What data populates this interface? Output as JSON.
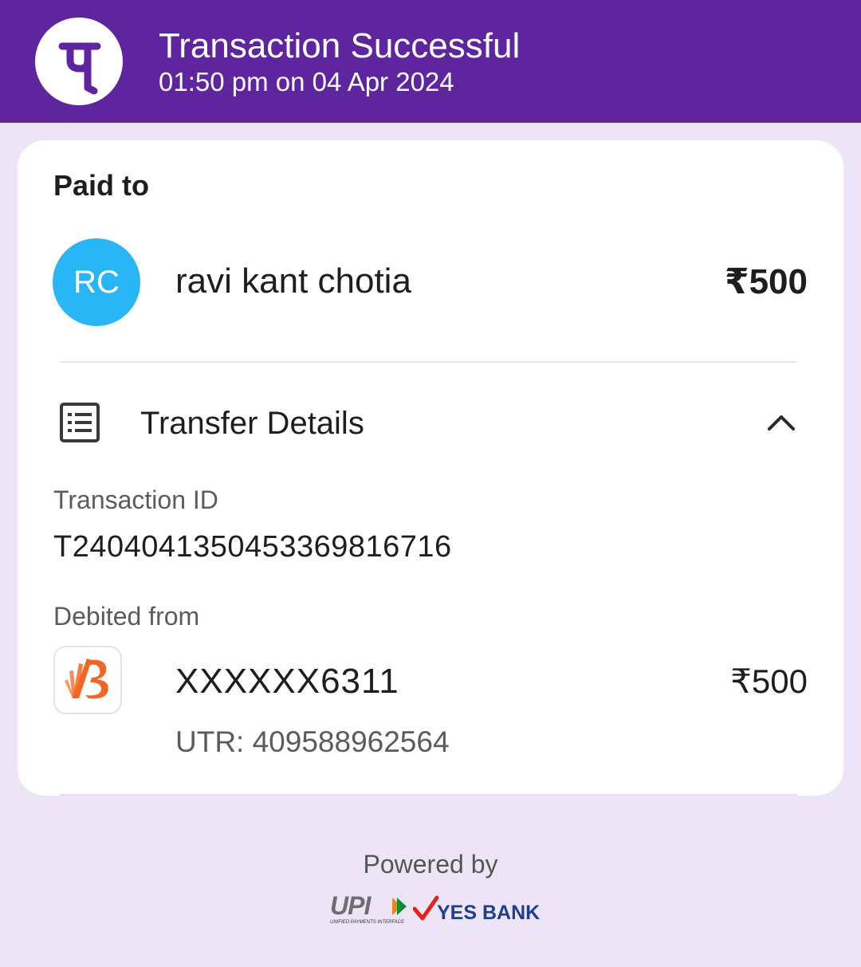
{
  "header": {
    "title": "Transaction Successful",
    "subtitle": "01:50 pm on 04 Apr 2024",
    "logo_icon": "phonepe-logo",
    "bg_color": "#5f259f"
  },
  "paid_to": {
    "label": "Paid to",
    "avatar_initials": "RC",
    "avatar_color": "#29b6f6",
    "name": "ravi kant chotia",
    "amount": "₹500"
  },
  "transfer_details": {
    "title": "Transfer Details",
    "icon": "receipt-list-icon",
    "toggle_icon": "chevron-up-icon",
    "transaction_id_label": "Transaction ID",
    "transaction_id": "T2404041350453369816716",
    "debited_from_label": "Debited from",
    "bank_icon": "bank-of-baroda-logo",
    "account": "XXXXXX6311",
    "amount": "₹500",
    "utr": "UTR: 409588962564"
  },
  "footer": {
    "powered_by": "Powered by",
    "upi_logo_text": "UPI",
    "upi_logo_subtext": "UNIFIED PAYMENTS INTERFACE",
    "partner_bank": "YES BANK"
  }
}
